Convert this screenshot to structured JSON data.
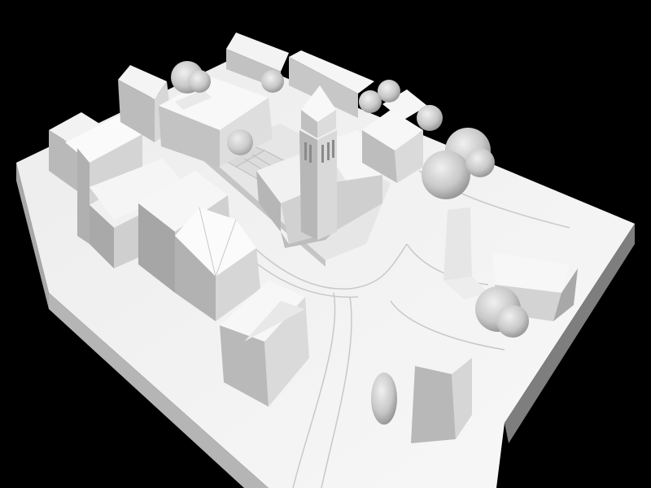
{
  "image": {
    "subject": "architectural-massing-model",
    "palette": {
      "background": "#000000",
      "base_top": "#f4f4f4",
      "base_side": "#bdbdbd",
      "wall_light": "#f7f7f7",
      "wall_mid": "#dedede",
      "wall_dark": "#b4b4b4",
      "road_line": "#c9c9c9",
      "tree_light": "#d9d9d9",
      "tree_dark": "#9a9a9a",
      "shadow": "#d0d0d0"
    }
  }
}
